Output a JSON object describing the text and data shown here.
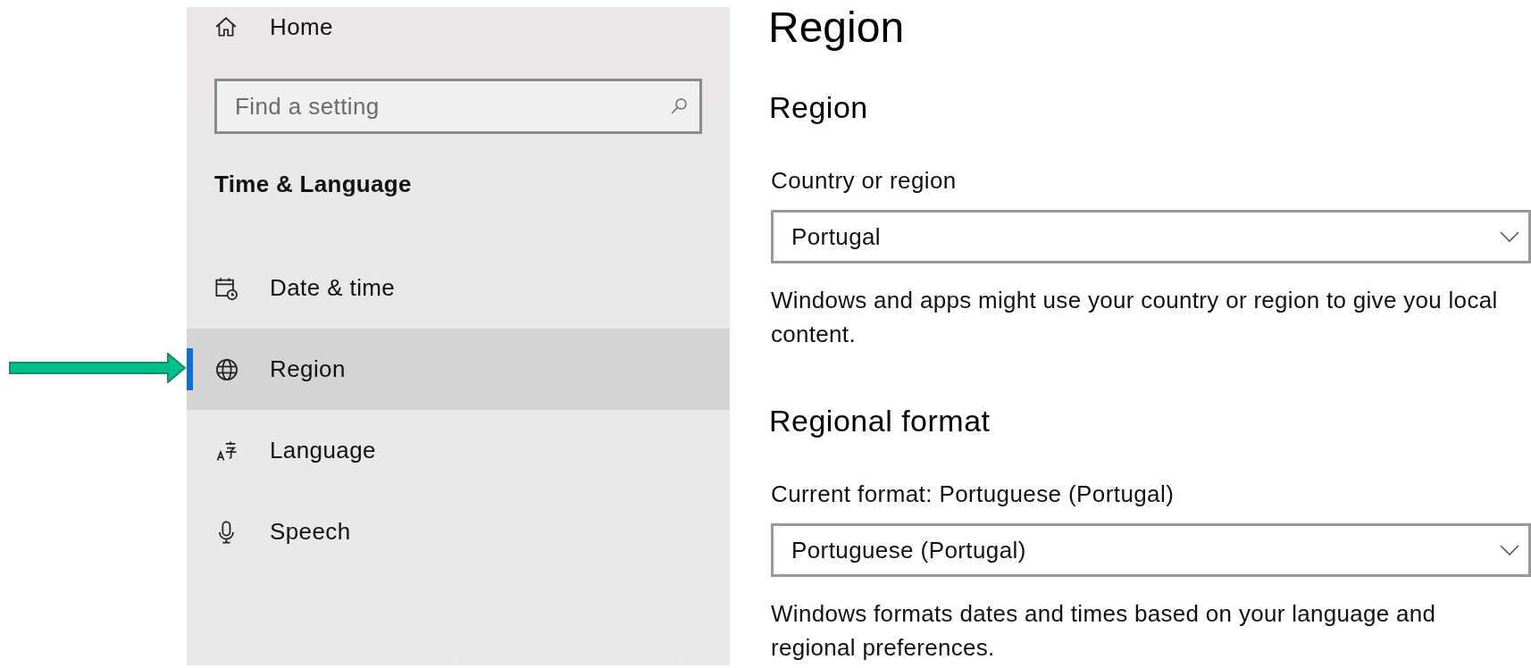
{
  "sidebar": {
    "home": {
      "label": "Home"
    },
    "search": {
      "placeholder": "Find a setting"
    },
    "section_title": "Time & Language",
    "items": [
      {
        "label": "Date & time",
        "kind": "calendar",
        "selected": false
      },
      {
        "label": "Region",
        "kind": "globe",
        "selected": true
      },
      {
        "label": "Language",
        "kind": "language",
        "selected": false
      },
      {
        "label": "Speech",
        "kind": "microphone",
        "selected": false
      }
    ]
  },
  "page": {
    "title": "Region",
    "sections": [
      {
        "heading": "Region",
        "field_label": "Country or region",
        "value": "Portugal",
        "description": "Windows and apps might use your country or region to give you local content."
      },
      {
        "heading": "Regional format",
        "field_label": "Current format: Portuguese (Portugal)",
        "value": "Portuguese (Portugal)",
        "description": "Windows formats dates and times based on your language and regional preferences."
      }
    ]
  }
}
